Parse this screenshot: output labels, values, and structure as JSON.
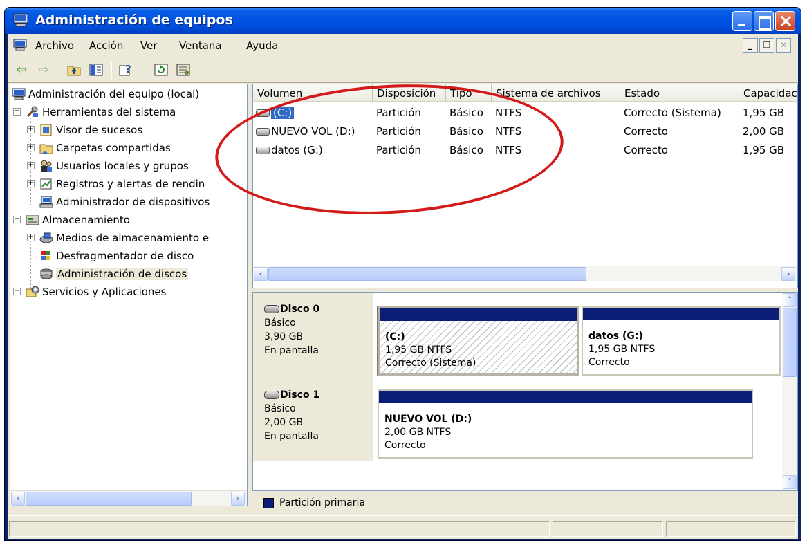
{
  "window": {
    "title": "Administración de equipos"
  },
  "menubar": {
    "items": [
      {
        "label": "Archivo"
      },
      {
        "label": "Acción"
      },
      {
        "label": "Ver"
      },
      {
        "label": "Ventana"
      },
      {
        "label": "Ayuda"
      }
    ]
  },
  "toolbar": {
    "icons": [
      "back-arrow-icon",
      "forward-arrow-icon",
      "up-folder-icon",
      "show-hide-tree-icon",
      "help-icon",
      "refresh-icon",
      "properties-icon"
    ]
  },
  "tree": {
    "items": [
      {
        "label": "Administración del equipo (local)",
        "icon": "computer-icon"
      },
      {
        "label": "Herramientas del sistema",
        "icon": "tools-icon"
      },
      {
        "label": "Visor de sucesos",
        "icon": "event-viewer-icon"
      },
      {
        "label": "Carpetas compartidas",
        "icon": "shared-folders-icon"
      },
      {
        "label": "Usuarios locales y grupos",
        "icon": "users-icon"
      },
      {
        "label": "Registros y alertas de rendin",
        "icon": "performance-logs-icon"
      },
      {
        "label": "Administrador de dispositivos",
        "icon": "device-manager-icon"
      },
      {
        "label": "Almacenamiento",
        "icon": "storage-icon"
      },
      {
        "label": "Medios de almacenamiento e",
        "icon": "removable-storage-icon"
      },
      {
        "label": "Desfragmentador de disco",
        "icon": "defragmenter-icon"
      },
      {
        "label": "Administración de discos",
        "icon": "disk-management-icon"
      },
      {
        "label": "Servicios y Aplicaciones",
        "icon": "services-icon"
      }
    ]
  },
  "volumes": {
    "columns": [
      "Volumen",
      "Disposición",
      "Tipo",
      "Sistema de archivos",
      "Estado",
      "Capacidac"
    ],
    "rows": [
      {
        "volume": "(C:)",
        "layout": "Partición",
        "type": "Básico",
        "fs": "NTFS",
        "status": "Correcto (Sistema)",
        "capacity": "1,95 GB"
      },
      {
        "volume": "NUEVO VOL (D:)",
        "layout": "Partición",
        "type": "Básico",
        "fs": "NTFS",
        "status": "Correcto",
        "capacity": "2,00 GB"
      },
      {
        "volume": "datos (G:)",
        "layout": "Partición",
        "type": "Básico",
        "fs": "NTFS",
        "status": "Correcto",
        "capacity": "1,95 GB"
      }
    ]
  },
  "disks": [
    {
      "name": "Disco 0",
      "kind": "Básico",
      "size": "3,90 GB",
      "state": "En pantalla",
      "partitions": [
        {
          "name": "(C:)",
          "size_fs": "1,95 GB NTFS",
          "status": "Correcto (Sistema)"
        },
        {
          "name": "datos  (G:)",
          "size_fs": "1,95 GB NTFS",
          "status": "Correcto"
        }
      ]
    },
    {
      "name": "Disco 1",
      "kind": "Básico",
      "size": "2,00 GB",
      "state": "En pantalla",
      "partitions": [
        {
          "name": "NUEVO VOL  (D:)",
          "size_fs": "2,00 GB NTFS",
          "status": "Correcto"
        }
      ]
    }
  ],
  "legend": {
    "label": "Partición primaria",
    "color": "#0b1e77"
  },
  "colors": {
    "title_bar": "#0054e3",
    "partition_bar": "#0b1e77",
    "annotation_ellipse": "#d21a1a"
  }
}
